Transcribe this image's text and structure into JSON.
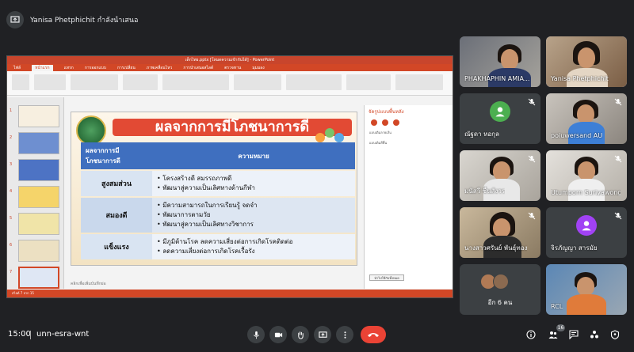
{
  "presenter": {
    "text": "Yanisa Phetphichit กำลังนำเสนอ"
  },
  "ppt": {
    "window_title": "เด็กไทย.pptx [โหมดความเข้ากันได้] - PowerPoint",
    "tabs": [
      "ไฟล์",
      "หน้าแรก",
      "แทรก",
      "การออกแบบ",
      "การเปลี่ยน",
      "ภาพเคลื่อนไหว",
      "การนำเสนอสไลด์",
      "ตรวจทาน",
      "มุมมอง"
    ],
    "active_tab": "หน้าแรก",
    "slide_numbers": [
      "1",
      "2",
      "3",
      "4",
      "5",
      "6",
      "7"
    ],
    "notes_placeholder": "คลิกเพื่อเพิ่มบันทึกย่อ",
    "status": "สไลด์ 7 จาก 15",
    "anim_pane_title": "จัดรูปแบบพื้นหลัง",
    "anim_pane_row1": "แบบเติมลายเส้น",
    "anim_pane_row2": "แบบเติมสีพื้น",
    "anim_pane_button": "นำไปใช้กับทั้งหมด"
  },
  "slide": {
    "title": "ผลจากการมีโภชนาการดี",
    "col_header_0": "ผลจากการมีโภชนาการดี",
    "col_header_1": "ความหมาย",
    "rows": [
      {
        "label": "สูงสมส่วน",
        "items": [
          "โครงสร้างดี สมรรถภาพดี",
          "พัฒนาสู่ความเป็นเลิศทางด้านกีฬา"
        ]
      },
      {
        "label": "สมองดี",
        "items": [
          "มีความสามารถในการเรียนรู้ จดจำ",
          "พัฒนาการตามวัย",
          "พัฒนาสู่ความเป็นเลิศทางวิชาการ"
        ]
      },
      {
        "label": "แข็งแรง",
        "items": [
          "มีภูมิต้านโรค ลดความเสี่ยงต่อการเกิดโรคติดต่อ",
          "ลดความเสี่ยงต่อการเกิดโรคเรื้อรัง"
        ]
      }
    ]
  },
  "participants": [
    {
      "name": "PHAKHAPHIN AMIA...",
      "muted": false,
      "speaking": false
    },
    {
      "name": "Yanisa Phetphichit",
      "muted": false,
      "speaking": true
    },
    {
      "name": "ณัฐดา หอกุล",
      "muted": true,
      "avatar_letter": "",
      "avatar_color": "#4caf50"
    },
    {
      "name": "poiuwersand AU",
      "muted": true
    },
    {
      "name": "มนัสวี ชื่นสังวร",
      "muted": true
    },
    {
      "name": "Utumporn Suriyawong",
      "muted": true
    },
    {
      "name": "นางสาวศรันย์ พันธุ์ทอง",
      "muted": true
    },
    {
      "name": "จิรภัญญา สารมัย",
      "muted": true,
      "avatar_letter": "",
      "avatar_color": "#a142f4"
    },
    {
      "name": "อีก 6 คน"
    },
    {
      "name": "RCL",
      "muted": false
    }
  ],
  "bottom": {
    "time": "15:00",
    "meeting_code": "unn-esra-wnt",
    "participant_count": "16"
  },
  "colors": {
    "background": "#202124",
    "tile": "#3c4043",
    "end_call": "#ea4335",
    "ppt_accent": "#d24726",
    "slide_title_bg": "#e24a34",
    "table_header": "#3f6fbf"
  },
  "icons": [
    "meet-logo-icon",
    "mic-icon",
    "camera-icon",
    "raise-hand-icon",
    "present-icon",
    "more-icon",
    "end-call-icon",
    "info-icon",
    "people-icon",
    "chat-icon",
    "activities-icon",
    "host-controls-icon",
    "mic-off-icon"
  ]
}
